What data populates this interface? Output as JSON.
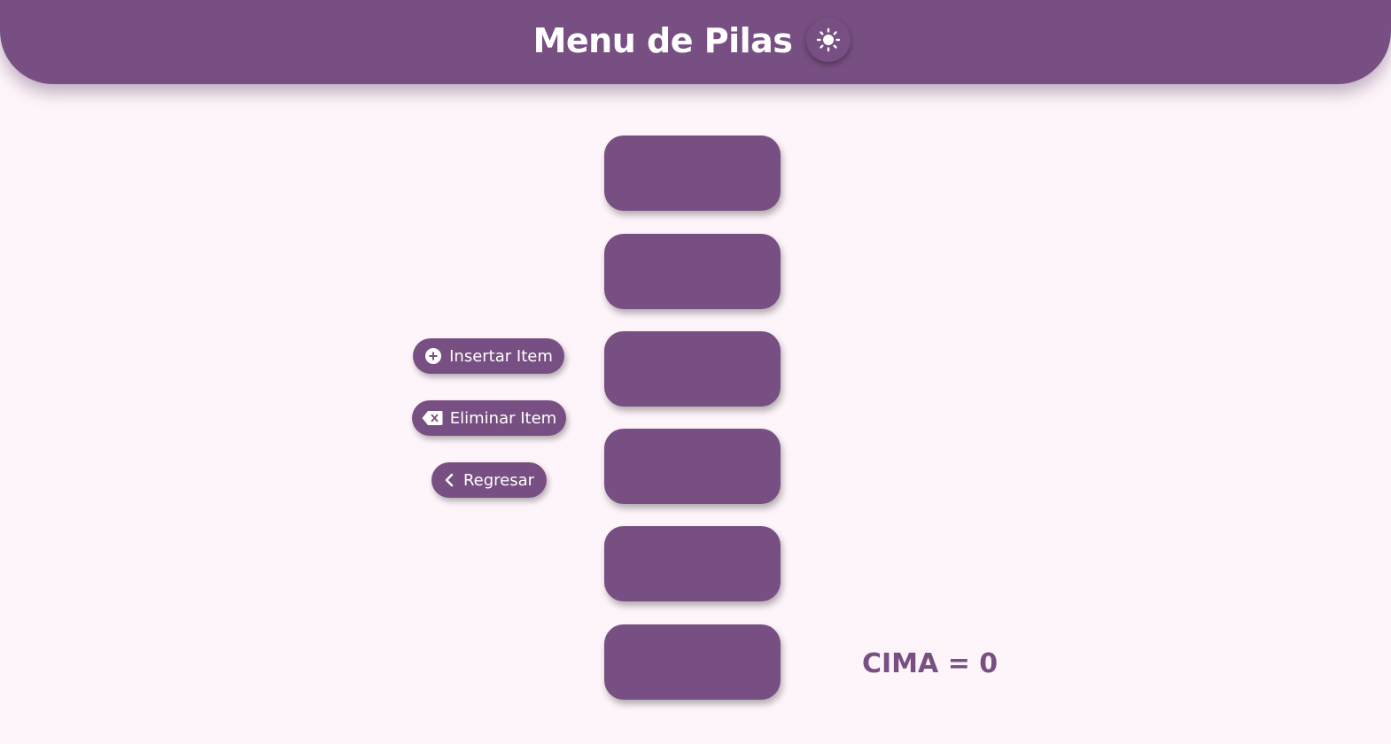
{
  "header": {
    "title": "Menu de Pilas",
    "theme_toggle_icon": "sun-icon"
  },
  "actions": {
    "insert": {
      "label": "Insertar Item",
      "icon": "plus-circle-icon"
    },
    "delete": {
      "label": "Eliminar Item",
      "icon": "backspace-icon"
    },
    "back": {
      "label": "Regresar",
      "icon": "chevron-left-icon"
    }
  },
  "stack": {
    "slots": [
      "",
      "",
      "",
      "",
      "",
      ""
    ]
  },
  "status": {
    "top_label": "CIMA = 0"
  },
  "colors": {
    "accent": "#784F82",
    "background": "#FEF5FA",
    "text_on_accent": "#FFFFFF"
  }
}
